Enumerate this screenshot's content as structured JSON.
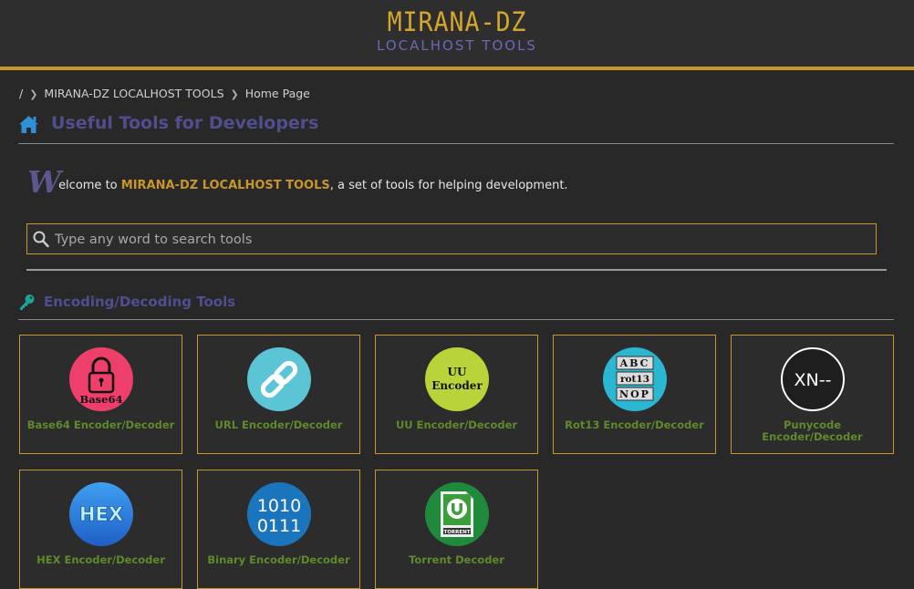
{
  "header": {
    "brand_title": "MIRANA-DZ",
    "brand_subtitle": "LOCALHOST TOOLS",
    "accent_color": "#c8962a"
  },
  "breadcrumb": {
    "root": "/",
    "site": "MIRANA-DZ LOCALHOST TOOLS",
    "current": "Home Page"
  },
  "page": {
    "title": "Useful Tools for Developers",
    "title_icon": "home-icon"
  },
  "welcome": {
    "dropcap": "W",
    "text_before": "elcome to ",
    "brand": "MIRANA-DZ LOCALHOST TOOLS",
    "text_after": ", a set of tools for helping development."
  },
  "search": {
    "placeholder": "Type any word to search tools",
    "value": "",
    "icon": "search-icon"
  },
  "section": {
    "title": "Encoding/Decoding Tools",
    "icon": "key-icon"
  },
  "tools": [
    {
      "label": "Base64 Encoder/Decoder",
      "icon": "base64-lock-icon",
      "icon_text": "Base64",
      "color": "#ee3e6a"
    },
    {
      "label": "URL Encoder/Decoder",
      "icon": "link-chain-icon",
      "color": "#5cc5d5"
    },
    {
      "label": "UU Encoder/Decoder",
      "icon": "uu-encoder-icon",
      "icon_text_1": "UU",
      "icon_text_2": "Encoder",
      "color": "#b8d43a"
    },
    {
      "label": "Rot13 Encoder/Decoder",
      "icon": "rot13-icon",
      "icon_text_1": "ABC",
      "icon_text_2": "rot13",
      "icon_text_3": "NOP",
      "color": "#2bb6d2"
    },
    {
      "label": "Punycode Encoder/Decoder",
      "label_line1": "Punycode",
      "label_line2": "Encoder/Decoder",
      "icon": "punycode-icon",
      "icon_text": "XN--",
      "color": "#1e1e1e"
    },
    {
      "label": "HEX Encoder/Decoder",
      "icon": "hex-icon",
      "icon_text": "HEX",
      "color": "#2e7de0"
    },
    {
      "label": "Binary Encoder/Decoder",
      "icon": "binary-icon",
      "icon_text_1": "1010",
      "icon_text_2": "0111",
      "color": "#1b75bc"
    },
    {
      "label": "Torrent Decoder",
      "icon": "torrent-icon",
      "icon_text": "TORRENT",
      "color": "#1f8a3c"
    }
  ]
}
